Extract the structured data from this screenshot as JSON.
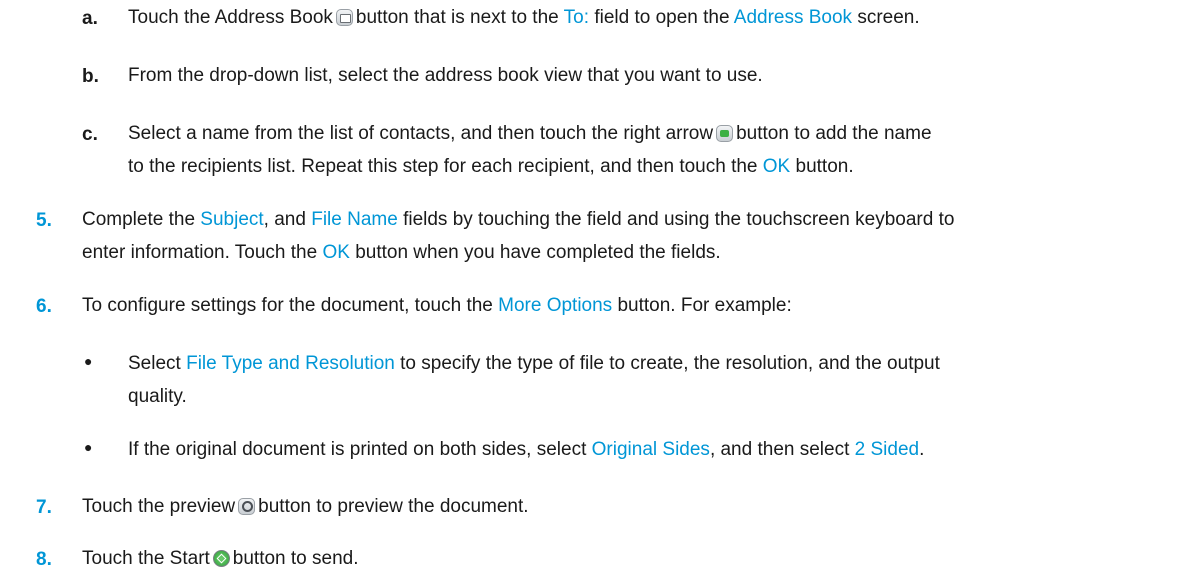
{
  "colors": {
    "link": "#0096d6",
    "body_text": "#1a1a1a"
  },
  "items": {
    "a": {
      "marker": "a.",
      "t1": "Touch the Address Book",
      "t2": "button that is next to the",
      "link1": "To:",
      "t3": "field to open the",
      "link2": "Address Book",
      "t4": "screen.",
      "icon": "address-book-icon"
    },
    "b": {
      "marker": "b.",
      "t1": "From the drop-down list, select the address book view that you want to use."
    },
    "c": {
      "marker": "c.",
      "line1_t1": "Select a name from the list of contacts, and then touch the right arrow",
      "line1_t2": "button to add the name",
      "line2_t1": "to the recipients list. Repeat this step for each recipient, and then touch the",
      "link1": "OK",
      "line2_t2": "button.",
      "icon": "right-arrow-icon"
    },
    "step5": {
      "marker": "5.",
      "t1": "Complete the",
      "link1": "Subject",
      "t2": ", and",
      "link2": "File Name",
      "t3": "fields by touching the field and using the touchscreen keyboard to",
      "line2_t1": "enter information. Touch the",
      "link3": "OK",
      "line2_t2": "button when you have completed the fields."
    },
    "step6": {
      "marker": "6.",
      "t1": "To configure settings for the document, touch the",
      "link1": "More Options",
      "t2": "button. For example:",
      "bullet1": {
        "marker": "●",
        "t1": "Select",
        "link1": "File Type and Resolution",
        "t2": "to specify the type of file to create, the resolution, and the output",
        "line2": "quality."
      },
      "bullet2": {
        "marker": "●",
        "t1": "If the original document is printed on both sides, select",
        "link1": "Original Sides",
        "t2": ", and then select",
        "link2": "2 Sided",
        "t3": "."
      }
    },
    "step7": {
      "marker": "7.",
      "t1": "Touch the preview",
      "t2": "button to preview the document.",
      "icon": "preview-icon"
    },
    "step8": {
      "marker": "8.",
      "t1": "Touch the Start",
      "t2": "button to send.",
      "icon": "start-icon"
    }
  }
}
